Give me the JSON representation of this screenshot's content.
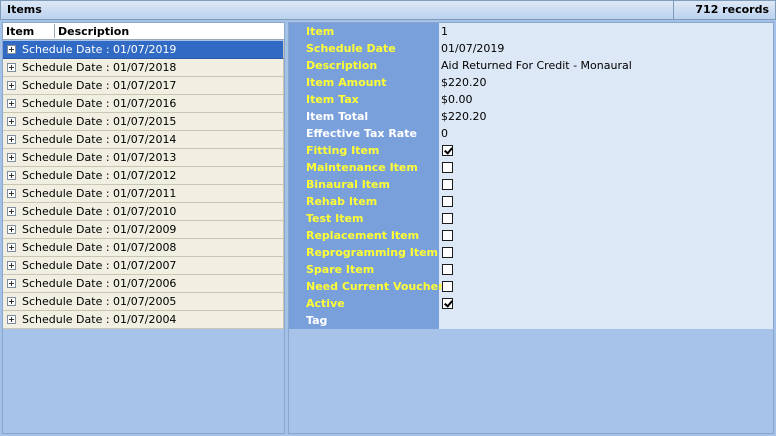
{
  "header": {
    "title": "Items",
    "records": "712 records"
  },
  "list": {
    "columns": [
      "Item",
      "Description"
    ],
    "items": [
      {
        "label": "Schedule Date : 01/07/2019",
        "selected": true
      },
      {
        "label": "Schedule Date : 01/07/2018"
      },
      {
        "label": "Schedule Date : 01/07/2017"
      },
      {
        "label": "Schedule Date : 01/07/2016"
      },
      {
        "label": "Schedule Date : 01/07/2015"
      },
      {
        "label": "Schedule Date : 01/07/2014"
      },
      {
        "label": "Schedule Date : 01/07/2013"
      },
      {
        "label": "Schedule Date : 01/07/2012"
      },
      {
        "label": "Schedule Date : 01/07/2011"
      },
      {
        "label": "Schedule Date : 01/07/2010"
      },
      {
        "label": "Schedule Date : 01/07/2009"
      },
      {
        "label": "Schedule Date : 01/07/2008"
      },
      {
        "label": "Schedule Date : 01/07/2007"
      },
      {
        "label": "Schedule Date : 01/07/2006"
      },
      {
        "label": "Schedule Date : 01/07/2005"
      },
      {
        "label": "Schedule Date : 01/07/2004"
      }
    ]
  },
  "properties": [
    {
      "name": "Item",
      "value": "1"
    },
    {
      "name": "Schedule Date",
      "value": "01/07/2019"
    },
    {
      "name": "Description",
      "value": "Aid Returned For Credit - Monaural"
    },
    {
      "name": "Item Amount",
      "value": "$220.20"
    },
    {
      "name": "Item Tax",
      "value": "$0.00"
    },
    {
      "name": "Item Total",
      "value": "$220.20",
      "label_color": "white"
    },
    {
      "name": "Effective Tax Rate",
      "value": "0",
      "label_color": "white"
    },
    {
      "name": "Fitting Item",
      "checked": true
    },
    {
      "name": "Maintenance Item",
      "checked": false
    },
    {
      "name": "Binaural Item",
      "checked": false
    },
    {
      "name": "Rehab Item",
      "checked": false
    },
    {
      "name": "Test Item",
      "checked": false
    },
    {
      "name": "Replacement Item",
      "checked": false
    },
    {
      "name": "Reprogramming Item",
      "checked": false
    },
    {
      "name": "Spare Item",
      "checked": false
    },
    {
      "name": "Need Current Voucher",
      "checked": false
    },
    {
      "name": "Active",
      "checked": true
    },
    {
      "name": "Tag",
      "value": "",
      "label_color": "white"
    }
  ]
}
